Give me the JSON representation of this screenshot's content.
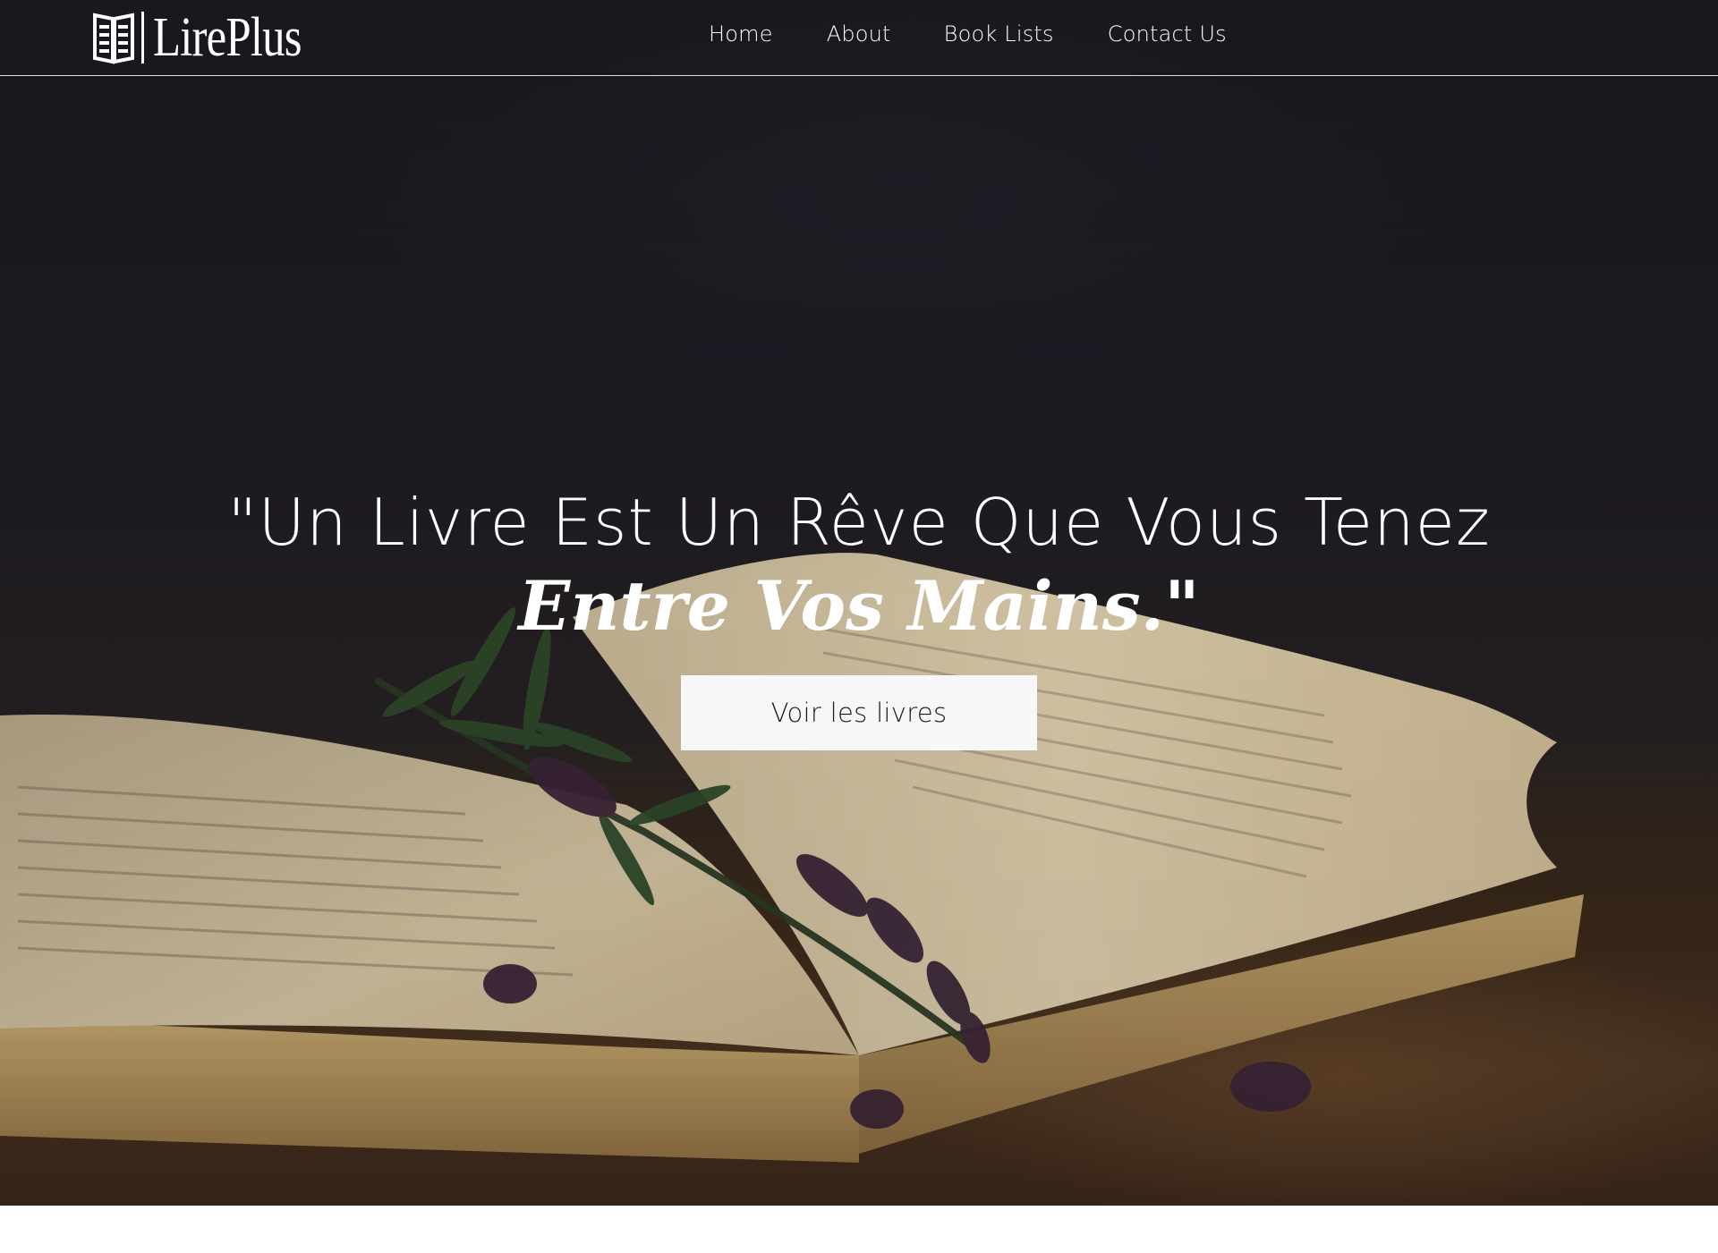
{
  "brand": {
    "name": "LirePlus",
    "icon": "open-book-icon"
  },
  "nav": {
    "items": [
      {
        "label": "Home"
      },
      {
        "label": "About"
      },
      {
        "label": "Book Lists"
      },
      {
        "label": "Contact Us"
      }
    ]
  },
  "hero": {
    "quote_line1": "\"Un Livre Est Un Rêve Que Vous Tenez",
    "quote_line2": "Entre Vos Mains.\"",
    "cta_label": "Voir les livres",
    "background": "open-book-with-lavender-photo"
  },
  "colors": {
    "nav_text": "#ffffff",
    "cta_background": "#f7f7f8",
    "cta_text": "#1b1b1b",
    "hero_dark": "#1c1a20"
  }
}
